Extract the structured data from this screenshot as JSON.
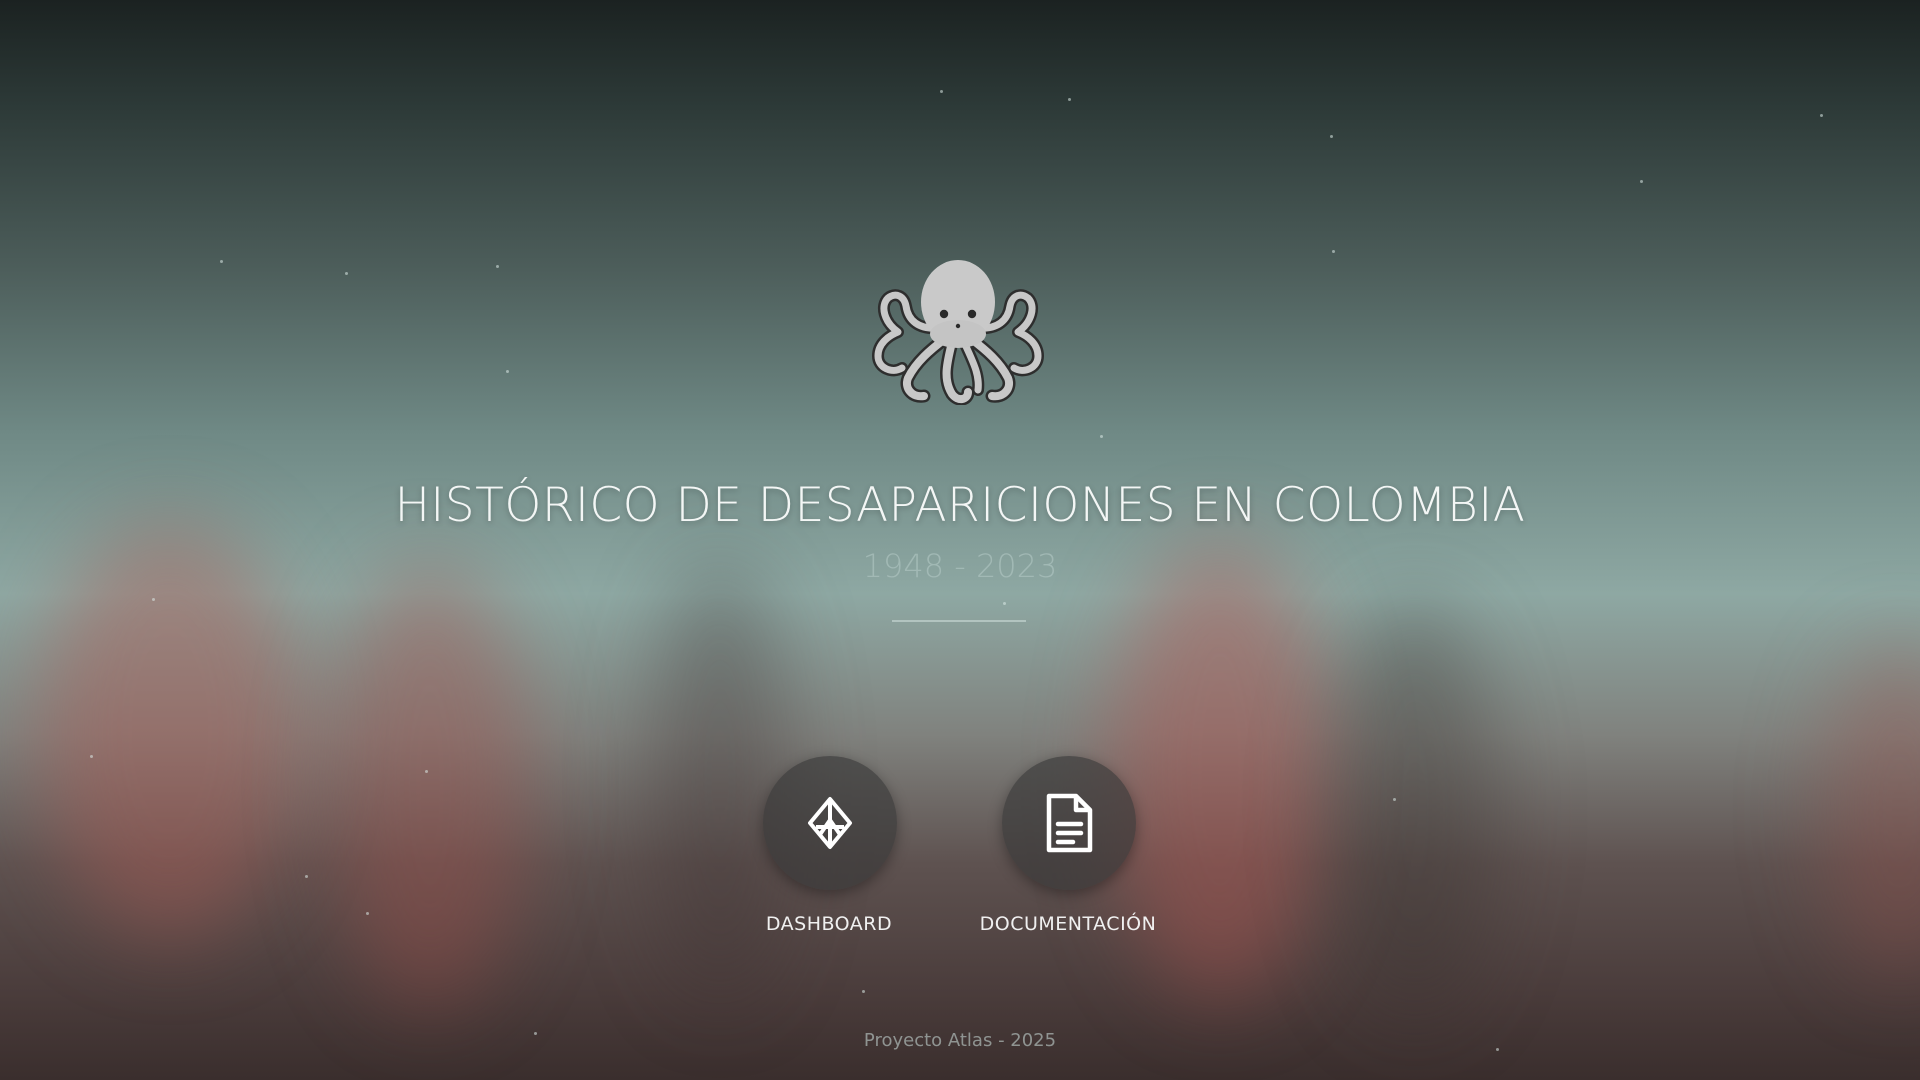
{
  "hero": {
    "logo_icon": "octopus-icon",
    "title": "HISTÓRICO DE DESAPARICIONES EN COLOMBIA",
    "years": "1948 - 2023"
  },
  "actions": [
    {
      "label": "DASHBOARD",
      "icon": "dashboard-icon"
    },
    {
      "label": "DOCUMENTACIÓN",
      "icon": "document-icon"
    }
  ],
  "footer": {
    "text": "Proyecto Atlas - 2025"
  },
  "colors": {
    "title": "#f3f6f5",
    "button_bg": "#373737",
    "background_top": "#1b2221",
    "background_mid": "#8ea8a3",
    "background_bottom": "#3a2e2d"
  }
}
